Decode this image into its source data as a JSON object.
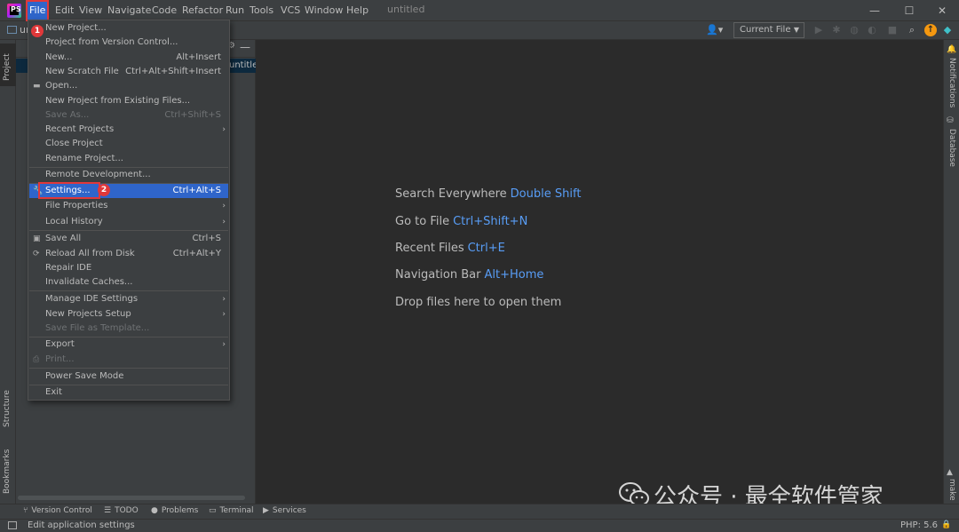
{
  "window": {
    "title": "untitled",
    "minimize": "—",
    "maximize": "☐",
    "close": "✕"
  },
  "menubar": {
    "items": [
      {
        "label": "File"
      },
      {
        "label": "Edit"
      },
      {
        "label": "View"
      },
      {
        "label": "Navigate"
      },
      {
        "label": "Code"
      },
      {
        "label": "Refactor"
      },
      {
        "label": "Run"
      },
      {
        "label": "Tools"
      },
      {
        "label": "VCS"
      },
      {
        "label": "Window"
      },
      {
        "label": "Help"
      }
    ]
  },
  "toolbar": {
    "project_crumb": "un",
    "run_config": "Current File"
  },
  "project_panel": {
    "tab_label": "Project",
    "selected_row": "untitle"
  },
  "file_menu": {
    "items": [
      {
        "label": "New Project...",
        "shortcut": ""
      },
      {
        "label": "Project from Version Control...",
        "shortcut": ""
      },
      {
        "label": "New...",
        "shortcut": "Alt+Insert"
      },
      {
        "label": "New Scratch File",
        "shortcut": "Ctrl+Alt+Shift+Insert"
      },
      {
        "label": "Open...",
        "shortcut": ""
      },
      {
        "label": "New Project from Existing Files...",
        "shortcut": ""
      },
      {
        "label": "Save As...",
        "shortcut": "Ctrl+Shift+S"
      },
      {
        "label": "Recent Projects",
        "shortcut": ""
      },
      {
        "label": "Close Project",
        "shortcut": ""
      },
      {
        "label": "Rename Project...",
        "shortcut": ""
      },
      {
        "label": "Remote Development...",
        "shortcut": ""
      },
      {
        "label": "Settings...",
        "shortcut": "Ctrl+Alt+S"
      },
      {
        "label": "File Properties",
        "shortcut": ""
      },
      {
        "label": "Local History",
        "shortcut": ""
      },
      {
        "label": "Save All",
        "shortcut": "Ctrl+S"
      },
      {
        "label": "Reload All from Disk",
        "shortcut": "Ctrl+Alt+Y"
      },
      {
        "label": "Repair IDE",
        "shortcut": ""
      },
      {
        "label": "Invalidate Caches...",
        "shortcut": ""
      },
      {
        "label": "Manage IDE Settings",
        "shortcut": ""
      },
      {
        "label": "New Projects Setup",
        "shortcut": ""
      },
      {
        "label": "Save File as Template...",
        "shortcut": ""
      },
      {
        "label": "Export",
        "shortcut": ""
      },
      {
        "label": "Print...",
        "shortcut": ""
      },
      {
        "label": "Power Save Mode",
        "shortcut": ""
      },
      {
        "label": "Exit",
        "shortcut": ""
      }
    ]
  },
  "annotations": {
    "badge1": "1",
    "badge2": "2"
  },
  "editor_hints": [
    {
      "text": "Search Everywhere",
      "key": "Double Shift"
    },
    {
      "text": "Go to File",
      "key": "Ctrl+Shift+N"
    },
    {
      "text": "Recent Files",
      "key": "Ctrl+E"
    },
    {
      "text": "Navigation Bar",
      "key": "Alt+Home"
    },
    {
      "text": "Drop files here to open them",
      "key": ""
    }
  ],
  "left_stripe": {
    "structure": "Structure",
    "bookmarks": "Bookmarks"
  },
  "right_stripe": {
    "notifications": "Notifications",
    "database": "Database",
    "make": "make"
  },
  "bottom_tabs": [
    {
      "label": "Version Control",
      "icon": "branch-icon"
    },
    {
      "label": "TODO",
      "icon": "list-icon"
    },
    {
      "label": "Problems",
      "icon": "info-icon"
    },
    {
      "label": "Terminal",
      "icon": "terminal-icon"
    },
    {
      "label": "Services",
      "icon": "play-icon"
    }
  ],
  "status_bar": {
    "message": "Edit application settings",
    "php_version": "PHP: 5.6"
  },
  "watermark": {
    "text": "公众号 · 最全软件管家"
  },
  "colors": {
    "accent": "#2f65ca",
    "link": "#589df6",
    "annotation": "#e0383a"
  }
}
